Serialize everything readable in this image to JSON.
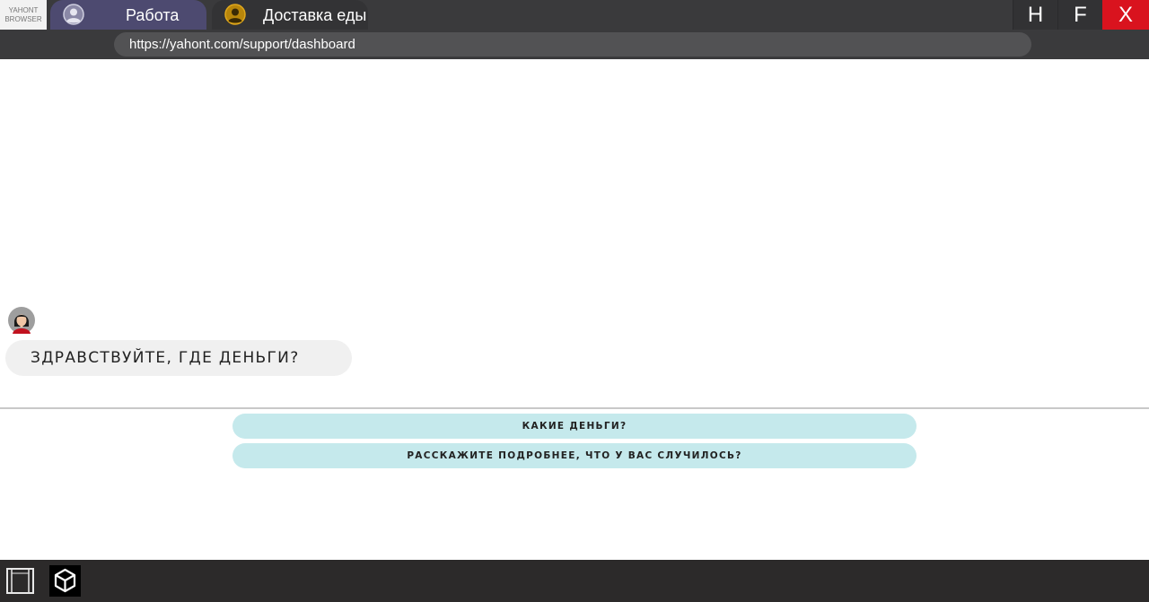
{
  "browser": {
    "logo_line1": "YAHONT",
    "logo_line2": "BROWSER",
    "tabs": [
      {
        "label": "Работа",
        "icon": "user-icon",
        "color": "#4d4a70"
      },
      {
        "label": "Доставка еды",
        "icon": "user-icon",
        "color": "#333335"
      }
    ],
    "window_controls": {
      "hide_label": "H",
      "fullscreen_label": "F",
      "close_label": "X",
      "close_color": "#d9131e"
    },
    "url": "https://yahont.com/support/dashboard"
  },
  "chat": {
    "avatar_icon": "woman-avatar-icon",
    "message": "ЗДРАВСТВУЙТЕ, ГДЕ ДЕНЬГИ?"
  },
  "replies": [
    {
      "label": "КАКИЕ ДЕНЬГИ?"
    },
    {
      "label": "РАССКАЖИТЕ ПОДРОБНЕЕ, ЧТО У ВАС СЛУЧИЛОСЬ?"
    }
  ],
  "taskbar": {
    "icons": [
      "window-frame-icon",
      "unity-logo-icon"
    ]
  }
}
